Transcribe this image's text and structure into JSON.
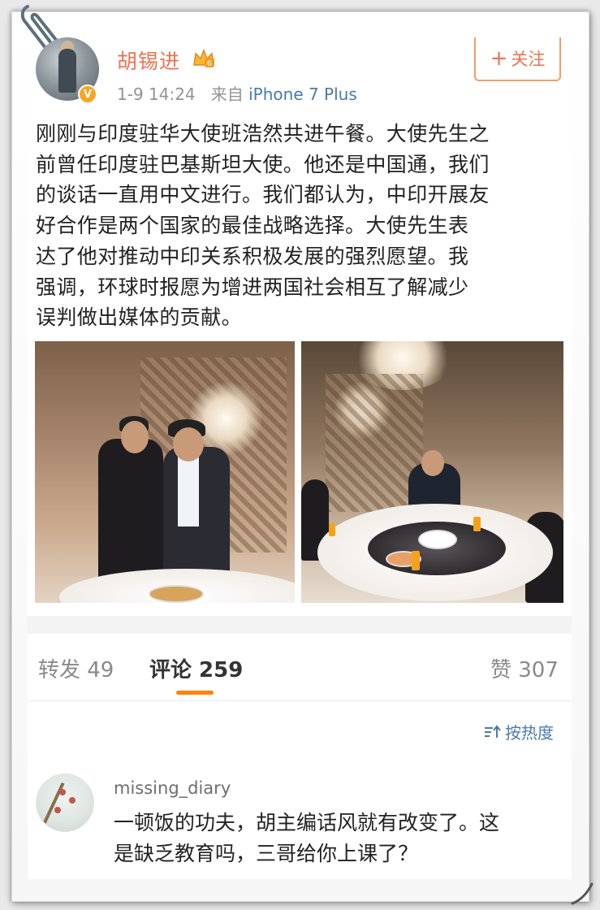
{
  "post": {
    "username": "胡锡进",
    "time": "1-9 14:24",
    "source_prefix": "来自",
    "source": "iPhone 7 Plus",
    "verified_badge": "V",
    "follow_plus": "+",
    "follow_label": "关注",
    "text_lines": [
      "刚刚与印度驻华大使班浩然共进午餐。大使先生之",
      "前曾任印度驻巴基斯坦大使。他还是中国通，我们",
      "的谈话一直用中文进行。我们都认为，中印开展友",
      "好合作是两个国家的最佳战略选择。大使先生表",
      "达了他对推动中印关系积极发展的强烈愿望。我",
      "强调，环球时报愿为增进两国社会相互了解减少",
      "误判做出媒体的贡献。"
    ]
  },
  "tabs": {
    "forward": "转发 49",
    "comment": "评论 259",
    "like": "赞 307",
    "sort": "按热度"
  },
  "comment": {
    "username": "missing_diary",
    "text_lines": [
      "一顿饭的功夫，胡主编话风就有改变了。这",
      "是缺乏教育吗，三哥给你上课了？"
    ]
  },
  "colors": {
    "username": "#eb7350",
    "link": "#4a79b0",
    "tab_accent": "#ff8200"
  },
  "icons": [
    "paperclip-icon",
    "crown-icon",
    "verified-icon",
    "plus-icon",
    "sort-icon"
  ]
}
